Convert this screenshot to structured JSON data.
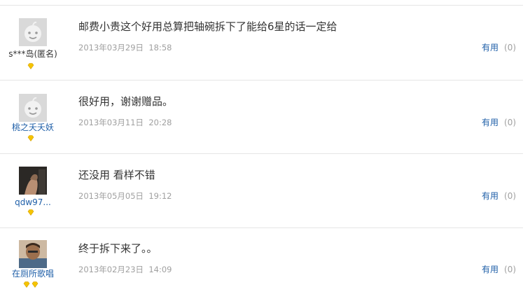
{
  "reviews": [
    {
      "user": "s***岛(匿名)",
      "avatar": "default-avatar",
      "level_badges": 1,
      "comment": "邮费小贵这个好用总算把轴碗拆下了能给6星的话一定给",
      "date": "2013年03月29日",
      "time": "18:58",
      "helpful_label": "有用",
      "helpful_count": "(0)"
    },
    {
      "user": "桃之夭夭妖",
      "avatar": "default-avatar",
      "level_badges": 1,
      "comment": "很好用，谢谢赠品。",
      "date": "2013年03月11日",
      "time": "20:28",
      "helpful_label": "有用",
      "helpful_count": "(0)"
    },
    {
      "user": "qdw97...",
      "avatar": "photo-avatar",
      "level_badges": 1,
      "comment": "还没用  看样不错",
      "date": "2013年05月05日",
      "time": "19:12",
      "helpful_label": "有用",
      "helpful_count": "(0)"
    },
    {
      "user": "在厕所歌唱",
      "avatar": "photo-avatar",
      "level_badges": 2,
      "comment": "终于拆下来了。。",
      "date": "2013年02月23日",
      "time": "14:09",
      "helpful_label": "有用",
      "helpful_count": "(0)"
    }
  ],
  "colors": {
    "link": "#1f5fa8",
    "muted": "#a0a0a0",
    "text": "#333333",
    "divider": "#e5e5e5",
    "badge": "#f5c400"
  }
}
